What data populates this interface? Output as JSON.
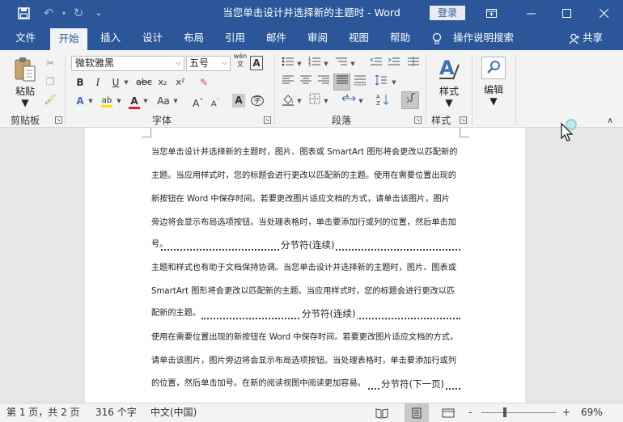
{
  "window": {
    "title": "当您单击设计并选择新的主题时  -  Word",
    "login_label": "登录",
    "save_icon": "save-icon",
    "undo_icon": "undo-icon",
    "redo_icon": "redo-icon"
  },
  "tabs": [
    {
      "label": "文件"
    },
    {
      "label": "开始",
      "active": true
    },
    {
      "label": "插入"
    },
    {
      "label": "设计"
    },
    {
      "label": "布局"
    },
    {
      "label": "引用"
    },
    {
      "label": "邮件"
    },
    {
      "label": "审阅"
    },
    {
      "label": "视图"
    },
    {
      "label": "帮助"
    }
  ],
  "tell_me": "操作说明搜索",
  "share": "共享",
  "ribbon": {
    "clipboard": {
      "label": "剪贴板",
      "paste": "粘贴"
    },
    "font": {
      "label": "字体",
      "name": "微软雅黑",
      "size": "五号",
      "phonetic": "wén",
      "strike": "abc",
      "aa": "Aa"
    },
    "paragraph": {
      "label": "段落"
    },
    "styles": {
      "label": "样式",
      "button": "样式"
    },
    "editing": {
      "label": "编辑",
      "button": "编辑"
    }
  },
  "document": {
    "lines": [
      "当您单击设计并选择新的主题时，图片、图表或  SmartArt  图形将会更改以匹配新的",
      "主题。当应用样式时，您的标题会进行更改以匹配新的主题。使用在需要位置出现的",
      "新按钮在  Word  中保存时间。若要更改图片适应文档的方式，请单击该图片，图片",
      "旁边将会显示布局选项按钮。当处理表格时，单击要添加行或列的位置，然后单击加",
      "号。",
      "主题和样式也有助于文档保持协调。当您单击设计并选择新的主题时，图片、图表或",
      "SmartArt  图形将会更改以匹配新的主题。当应用样式时，您的标题会进行更改以匹",
      "配新的主题。",
      "使用在需要位置出现的新按钮在  Word  中保存时间。若要更改图片适应文档的方式，",
      "请单击该图片，图片旁边将会显示布局选项按钮。当处理表格时，单击要添加行或列",
      "的位置，然后单击加号。在新的阅读视图中阅读更加容易。"
    ],
    "break1": "分节符(连续)",
    "break2": "分节符(连续)",
    "break3": "分节符(下一页)"
  },
  "status": {
    "page": "第 1 页，共 2 页",
    "words": "316 个字",
    "lang": "中文(中国)",
    "zoom": "69%",
    "zoom_fraction": 0.32,
    "minus": "-",
    "plus": "+"
  }
}
